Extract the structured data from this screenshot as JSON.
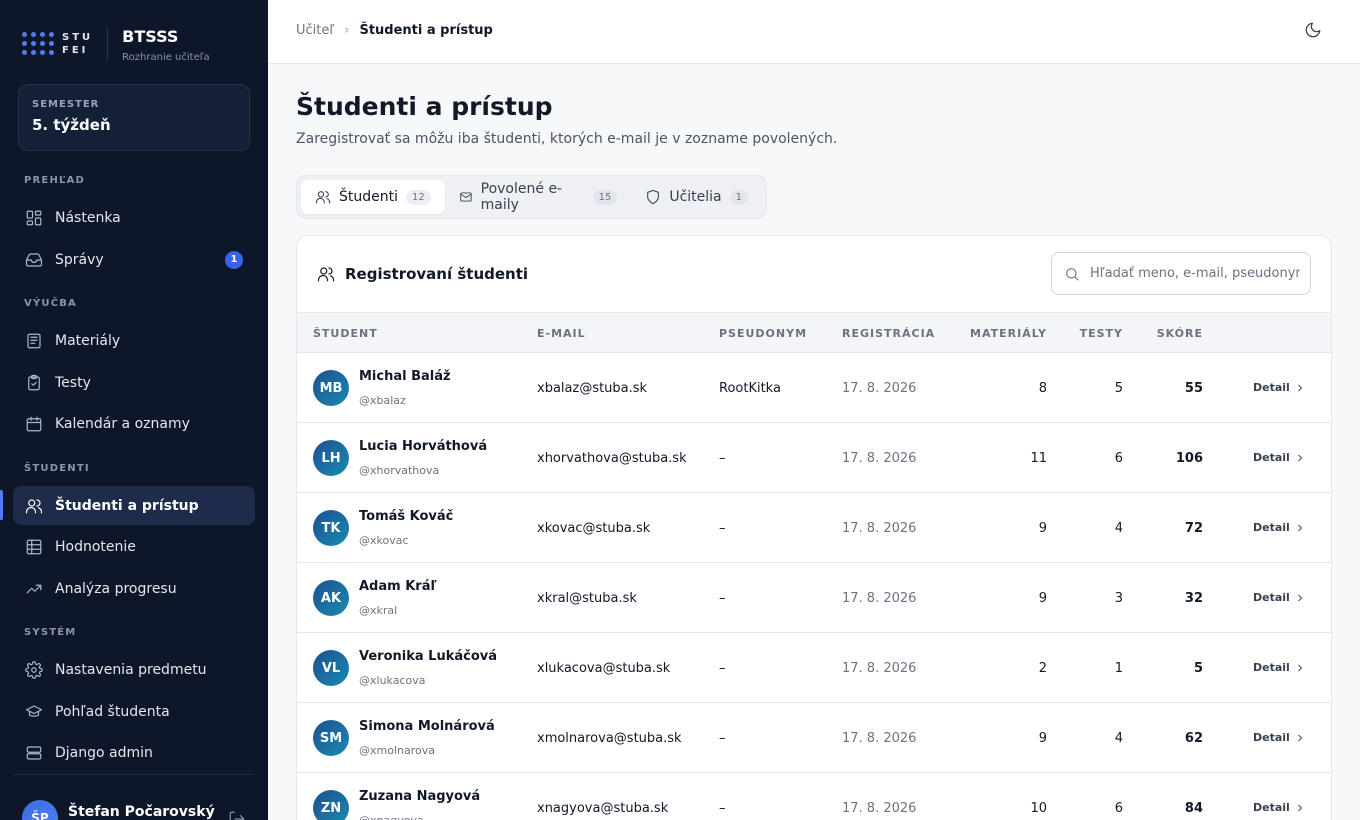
{
  "brand": {
    "logo_text_top": "STU",
    "logo_text_bottom": "FEI",
    "name": "BTSSS",
    "subtitle": "Rozhranie učiteľa"
  },
  "semester": {
    "label": "SEMESTER",
    "value": "5. týždeň"
  },
  "sidebar": {
    "sections": [
      "PREHĽAD",
      "VÝUČBA",
      "ŠTUDENTI",
      "SYSTÉM"
    ],
    "items": [
      {
        "label": "Nástenka",
        "icon": "dashboard-icon"
      },
      {
        "label": "Správy",
        "icon": "inbox-icon",
        "badge": "1"
      },
      {
        "label": "Materiály",
        "icon": "book-icon"
      },
      {
        "label": "Testy",
        "icon": "clipboard-check-icon"
      },
      {
        "label": "Kalendár a oznamy",
        "icon": "calendar-icon"
      },
      {
        "label": "Študenti a prístup",
        "icon": "users-icon",
        "active": true
      },
      {
        "label": "Hodnotenie",
        "icon": "grid-icon"
      },
      {
        "label": "Analýza progresu",
        "icon": "trending-up-icon"
      },
      {
        "label": "Nastavenia predmetu",
        "icon": "gear-icon"
      },
      {
        "label": "Pohľad študenta",
        "icon": "graduation-cap-icon"
      },
      {
        "label": "Django admin",
        "icon": "server-icon"
      }
    ],
    "user": {
      "initials": "ŠP",
      "name": "Štefan Počarovský"
    }
  },
  "breadcrumb": {
    "parent": "Učiteľ",
    "separator": "›",
    "current": "Študenti a prístup"
  },
  "page": {
    "title": "Študenti a prístup",
    "subtitle": "Zaregistrovať sa môžu iba študenti, ktorých e-mail je v zozname povolených."
  },
  "tabs": [
    {
      "label": "Študenti",
      "count": "12",
      "icon": "users-icon",
      "active": true
    },
    {
      "label": "Povolené e-maily",
      "count": "15",
      "icon": "mail-icon"
    },
    {
      "label": "Učitelia",
      "count": "1",
      "icon": "shield-icon"
    }
  ],
  "card": {
    "title": "Registrovaní študenti",
    "search_placeholder": "Hľadať meno, e-mail, pseudonym"
  },
  "table": {
    "headers": [
      "ŠTUDENT",
      "E-MAIL",
      "PSEUDONYM",
      "REGISTRÁCIA",
      "MATERIÁLY",
      "TESTY",
      "SKÓRE"
    ],
    "detail_label": "Detail",
    "rows": [
      {
        "initials": "MB",
        "name": "Michal Baláž",
        "handle": "@xbalaz",
        "email": "xbalaz@stuba.sk",
        "pseudonym": "RootKitka",
        "registered": "17. 8. 2026",
        "materials": "8",
        "tests": "5",
        "score": "55"
      },
      {
        "initials": "LH",
        "name": "Lucia Horváthová",
        "handle": "@xhorvathova",
        "email": "xhorvathova@stuba.sk",
        "pseudonym": "–",
        "registered": "17. 8. 2026",
        "materials": "11",
        "tests": "6",
        "score": "106"
      },
      {
        "initials": "TK",
        "name": "Tomáš Kováč",
        "handle": "@xkovac",
        "email": "xkovac@stuba.sk",
        "pseudonym": "–",
        "registered": "17. 8. 2026",
        "materials": "9",
        "tests": "4",
        "score": "72"
      },
      {
        "initials": "AK",
        "name": "Adam Kráľ",
        "handle": "@xkral",
        "email": "xkral@stuba.sk",
        "pseudonym": "–",
        "registered": "17. 8. 2026",
        "materials": "9",
        "tests": "3",
        "score": "32"
      },
      {
        "initials": "VL",
        "name": "Veronika Lukáčová",
        "handle": "@xlukacova",
        "email": "xlukacova@stuba.sk",
        "pseudonym": "–",
        "registered": "17. 8. 2026",
        "materials": "2",
        "tests": "1",
        "score": "5"
      },
      {
        "initials": "SM",
        "name": "Simona Molnárová",
        "handle": "@xmolnarova",
        "email": "xmolnarova@stuba.sk",
        "pseudonym": "–",
        "registered": "17. 8. 2026",
        "materials": "9",
        "tests": "4",
        "score": "62"
      },
      {
        "initials": "ZN",
        "name": "Zuzana Nagyová",
        "handle": "@xnagyova",
        "email": "xnagyova@stuba.sk",
        "pseudonym": "–",
        "registered": "17. 8. 2026",
        "materials": "10",
        "tests": "6",
        "score": "84"
      }
    ]
  },
  "colors": {
    "sidebar_bg": "#0e1629",
    "accent": "#4f7df5",
    "badge": "#3563e9"
  }
}
